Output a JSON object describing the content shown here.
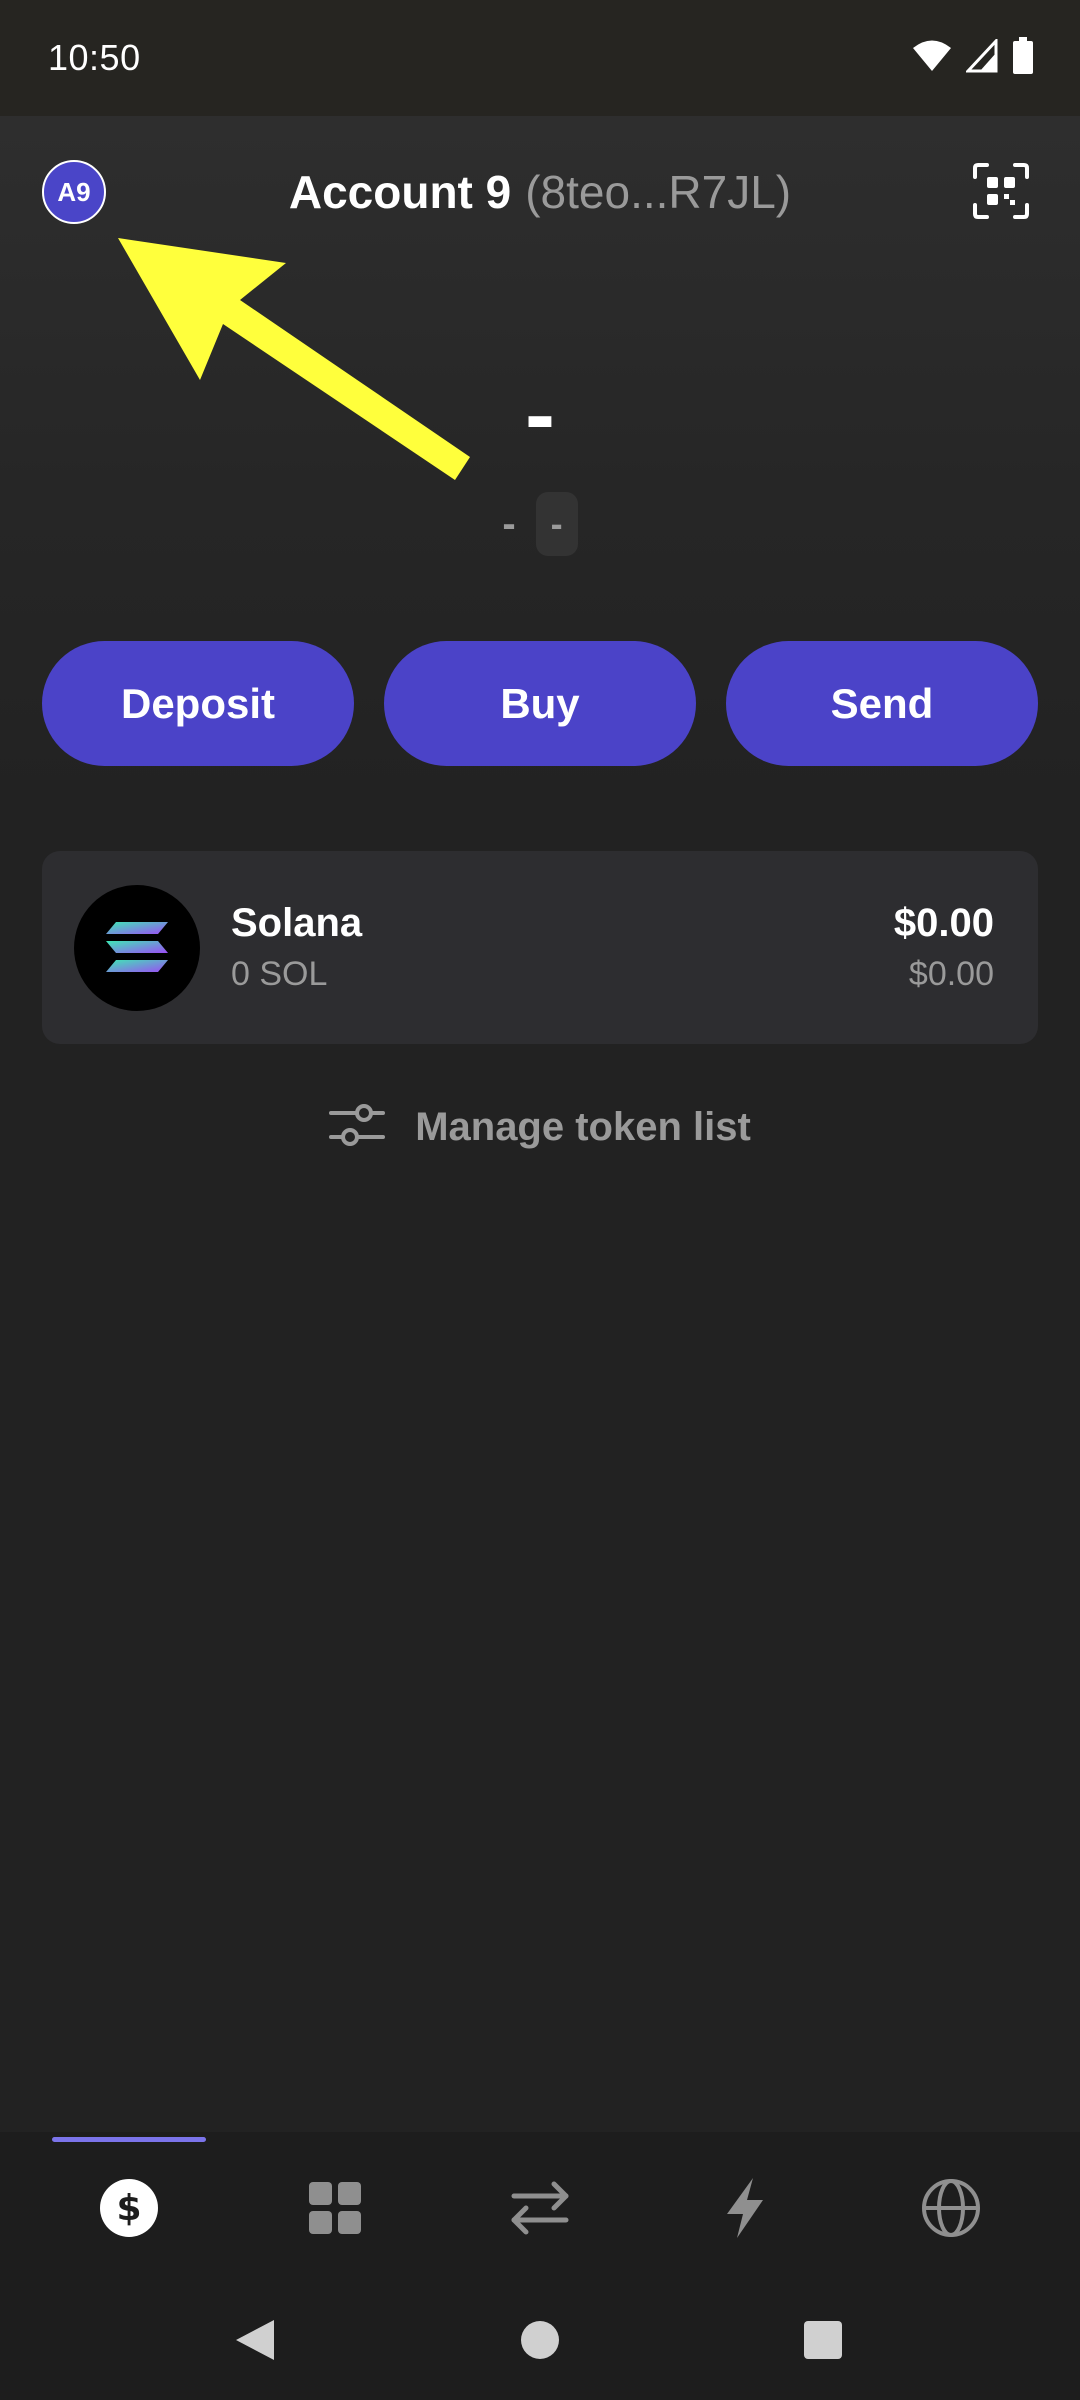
{
  "status_bar": {
    "time": "10:50",
    "icons": [
      "wifi-icon",
      "cellular-signal-icon",
      "battery-icon"
    ]
  },
  "header": {
    "avatar_initials": "A9",
    "account_name": "Account 9",
    "account_address": "(8teo...R7JL)",
    "qr_icon": "qr-scan-icon"
  },
  "balance": {
    "main": "-",
    "change": "-",
    "change_percent": "-"
  },
  "actions": {
    "deposit_label": "Deposit",
    "buy_label": "Buy",
    "send_label": "Send"
  },
  "tokens": [
    {
      "name": "Solana",
      "amount": "0 SOL",
      "value": "$0.00",
      "value_sub": "$0.00",
      "icon": "solana-logo"
    }
  ],
  "manage": {
    "label": "Manage token list",
    "icon": "sliders-icon"
  },
  "tab_bar": {
    "tabs": [
      {
        "icon": "dollar-icon",
        "active": true
      },
      {
        "icon": "collectibles-grid-icon",
        "active": false
      },
      {
        "icon": "swap-icon",
        "active": false
      },
      {
        "icon": "activity-bolt-icon",
        "active": false
      },
      {
        "icon": "globe-icon",
        "active": false
      }
    ],
    "accent": "#7b74ea"
  },
  "colors": {
    "primary": "#4b43c8",
    "background": "#222222",
    "card": "#2d2d30",
    "muted_text": "#9a9a9a",
    "annotation_arrow": "#ffff3c"
  }
}
